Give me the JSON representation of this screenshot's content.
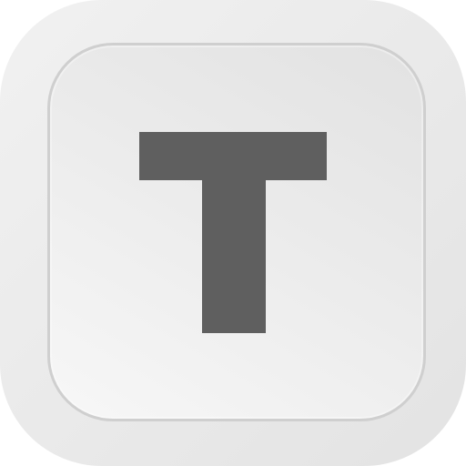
{
  "icon": {
    "letter": "T",
    "letter_color": "#5f5f5f",
    "outer_color": "#ececec",
    "key_border_color": "#cfcfcf",
    "glyph_name": "letter-t-glyph"
  }
}
